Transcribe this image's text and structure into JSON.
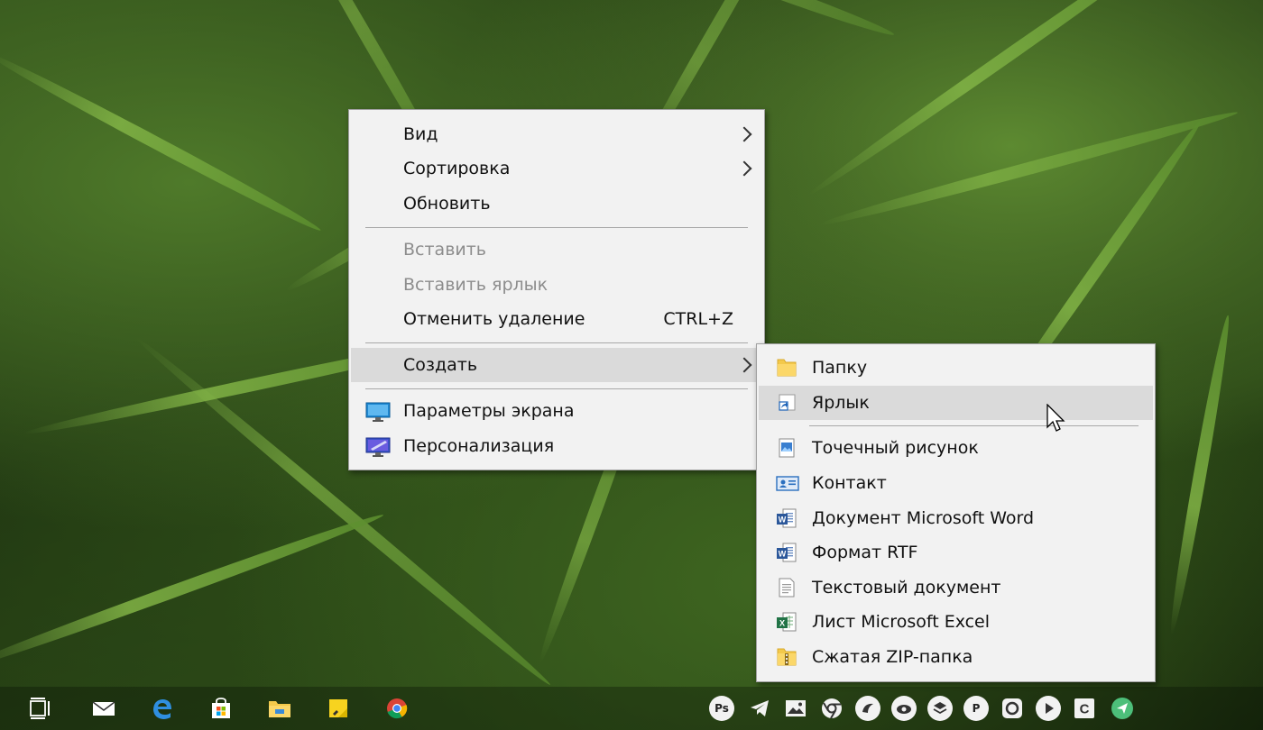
{
  "context_menu": {
    "items": [
      {
        "label": "Вид",
        "submenu": true
      },
      {
        "label": "Сортировка",
        "submenu": true
      },
      {
        "label": "Обновить"
      },
      {
        "label": "Вставить",
        "disabled": true
      },
      {
        "label": "Вставить ярлык",
        "disabled": true
      },
      {
        "label": "Отменить удаление",
        "shortcut": "CTRL+Z"
      },
      {
        "label": "Создать",
        "submenu": true,
        "highlighted": true
      },
      {
        "label": "Параметры экрана",
        "icon": "display-settings-icon"
      },
      {
        "label": "Персонализация",
        "icon": "personalization-icon"
      }
    ]
  },
  "create_submenu": {
    "items": [
      {
        "label": "Папку",
        "icon": "folder-icon"
      },
      {
        "label": "Ярлык",
        "icon": "shortcut-icon",
        "highlighted": true
      },
      {
        "label": "Точечный рисунок",
        "icon": "bitmap-icon"
      },
      {
        "label": "Контакт",
        "icon": "contact-icon"
      },
      {
        "label": "Документ Microsoft Word",
        "icon": "word-document-icon"
      },
      {
        "label": "Формат RTF",
        "icon": "rtf-document-icon"
      },
      {
        "label": "Текстовый документ",
        "icon": "text-document-icon"
      },
      {
        "label": "Лист Microsoft Excel",
        "icon": "excel-sheet-icon"
      },
      {
        "label": "Сжатая ZIP-папка",
        "icon": "zip-folder-icon"
      }
    ]
  },
  "taskbar": {
    "pinned": [
      "task-view-icon",
      "mail-icon",
      "edge-icon",
      "store-icon",
      "file-explorer-icon",
      "sticky-notes-icon",
      "chrome-icon"
    ],
    "tray": [
      {
        "icon": "photoshop-icon",
        "text": "Ps"
      },
      {
        "icon": "telegram-icon"
      },
      {
        "icon": "photos-icon"
      },
      {
        "icon": "chrome-icon"
      },
      {
        "icon": "app-icon-1"
      },
      {
        "icon": "app-icon-2"
      },
      {
        "icon": "stack-icon"
      },
      {
        "icon": "app-p-icon",
        "text": "P"
      },
      {
        "icon": "app-record-icon"
      },
      {
        "icon": "play-icon"
      },
      {
        "icon": "app-c-icon",
        "text": "C"
      },
      {
        "icon": "send-icon"
      }
    ]
  },
  "colors": {
    "menu_bg": "#f2f2f2",
    "highlight": "#dadada",
    "disabled_text": "#8d8d8d",
    "separator": "#a8a8a8"
  }
}
